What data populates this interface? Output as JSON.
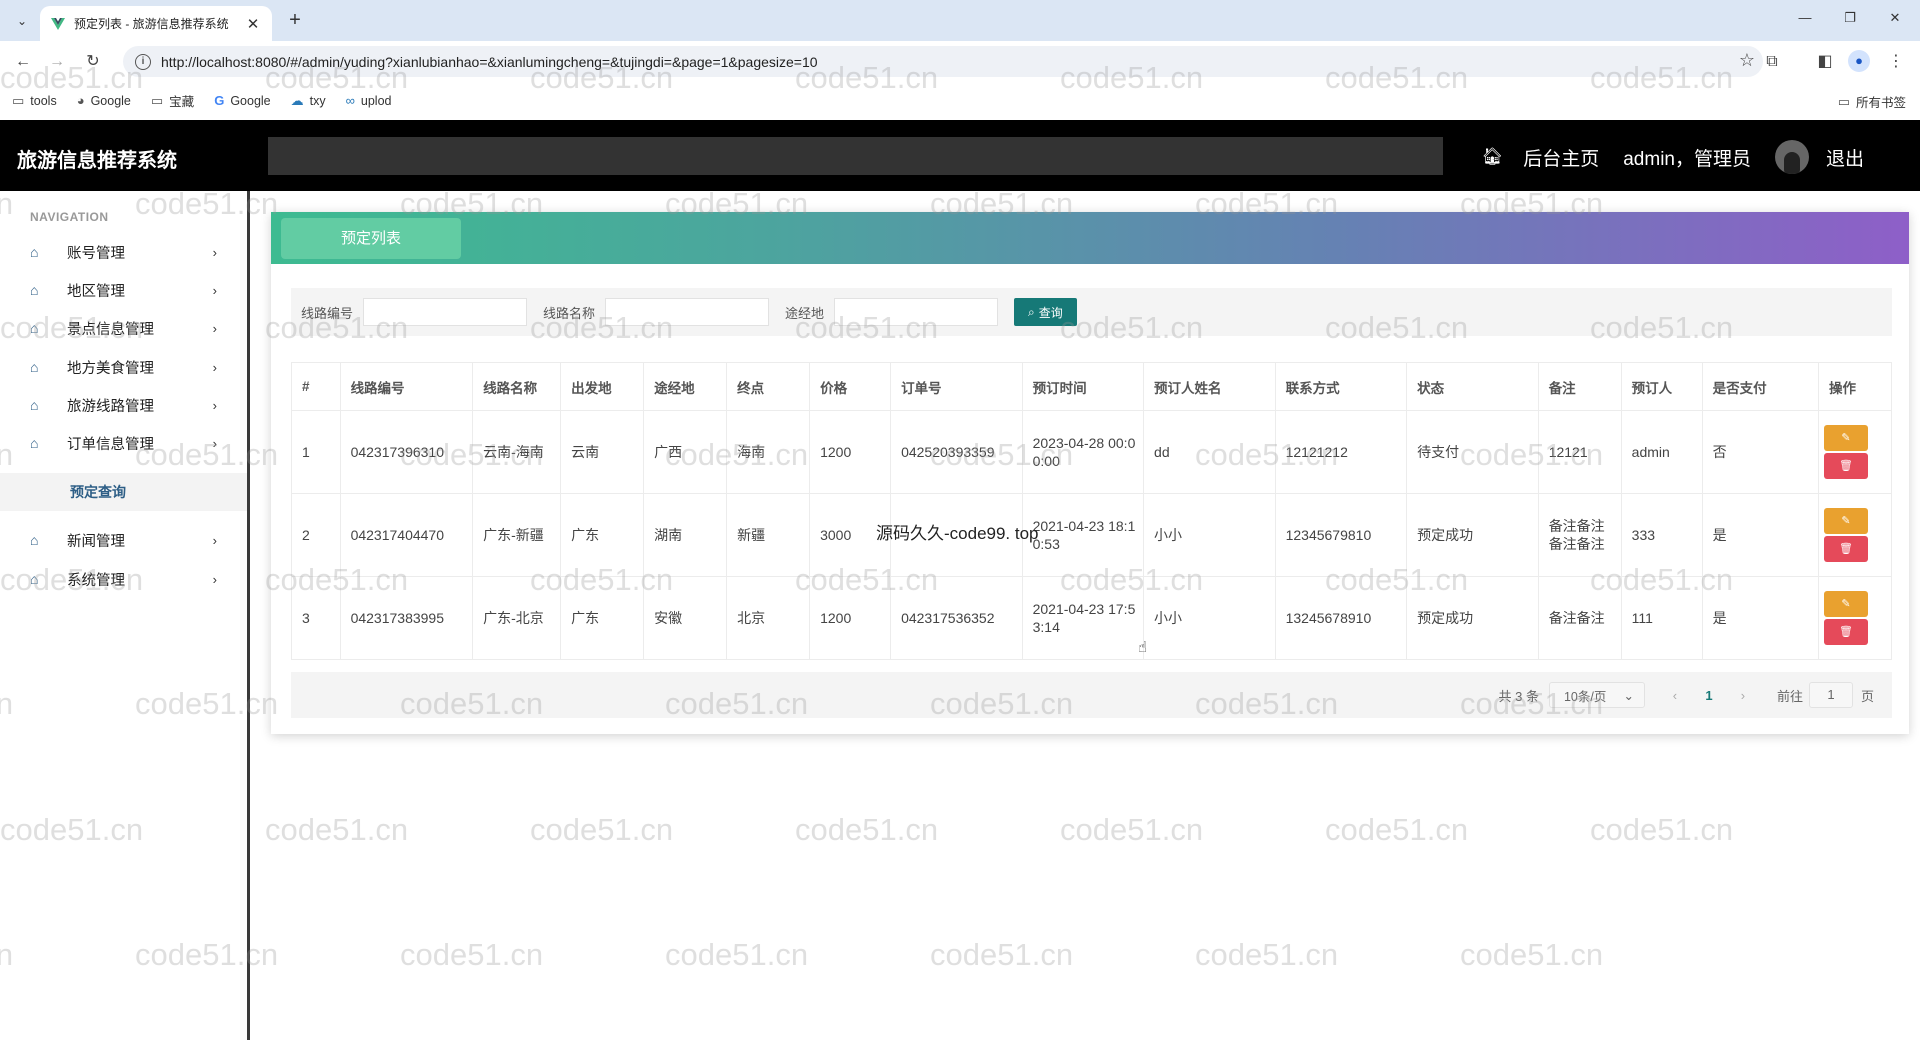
{
  "browser": {
    "tab_title": "预定列表 - 旅游信息推荐系统",
    "tab_close": "✕",
    "new_tab": "+",
    "url": "http://localhost:8080/#/admin/yuding?xianlubianhao=&xianlumingcheng=&tujingdi=&page=1&pagesize=10",
    "bookmarks": [
      {
        "icon": "folder-icon",
        "label": "tools"
      },
      {
        "icon": "globe-icon",
        "label": "Google"
      },
      {
        "icon": "folder-icon",
        "label": "宝藏"
      },
      {
        "icon": "google-icon",
        "label": "Google"
      },
      {
        "icon": "cloud-icon",
        "label": "txy"
      },
      {
        "icon": "link-icon",
        "label": "uplod"
      }
    ],
    "all_bookmarks": "所有书签"
  },
  "header": {
    "brand": "旅游信息推荐系统",
    "home": "后台主页",
    "user": "admin，管理员",
    "logout": "退出"
  },
  "sidebar": {
    "heading": "NAVIGATION",
    "items": [
      {
        "label": "账号管理"
      },
      {
        "label": "地区管理"
      },
      {
        "label": "景点信息管理"
      },
      {
        "label": "地方美食管理"
      },
      {
        "label": "旅游线路管理"
      },
      {
        "label": "订单信息管理"
      },
      {
        "label": "新闻管理"
      },
      {
        "label": "系统管理"
      }
    ],
    "submenu": {
      "label": "预定查询"
    }
  },
  "page": {
    "tab_label": "预定列表",
    "search": {
      "field1_label": "线路编号",
      "field2_label": "线路名称",
      "field3_label": "途经地",
      "button": "查询"
    },
    "table": {
      "columns": [
        "#",
        "线路编号",
        "线路名称",
        "出发地",
        "途经地",
        "终点",
        "价格",
        "订单号",
        "预订时间",
        "预订人姓名",
        "联系方式",
        "状态",
        "备注",
        "预订人",
        "是否支付",
        "操作"
      ],
      "rows": [
        [
          "1",
          "042317396310",
          "云南-海南",
          "云南",
          "广西",
          "海南",
          "1200",
          "042520393359",
          "2023-04-28 00:00:00",
          "dd",
          "12121212",
          "待支付",
          "12121",
          "admin",
          "否"
        ],
        [
          "2",
          "042317404470",
          "广东-新疆",
          "广东",
          "湖南",
          "新疆",
          "3000",
          "",
          "2021-04-23 18:10:53",
          "小小",
          "12345679810",
          "预定成功",
          "备注备注备注备注",
          "333",
          "是"
        ],
        [
          "3",
          "042317383995",
          "广东-北京",
          "广东",
          "安徽",
          "北京",
          "1200",
          "042317536352",
          "2021-04-23 17:53:14",
          "小小",
          "13245678910",
          "预定成功",
          "备注备注",
          "111",
          "是"
        ]
      ]
    },
    "pagination": {
      "total": "共 3 条",
      "page_size": "10条/页",
      "current": "1",
      "goto_label": "前往",
      "goto_value": "1",
      "page_suffix": "页"
    }
  },
  "overlay_text": "源码久久-code99. top",
  "watermark_text": "code51.cn",
  "colors": {
    "header_bg": "#000000",
    "accent": "#167977",
    "sidebar_icon": "#2d5e86",
    "edit_button": "#e9a12f",
    "delete_button": "#e54a5a"
  }
}
